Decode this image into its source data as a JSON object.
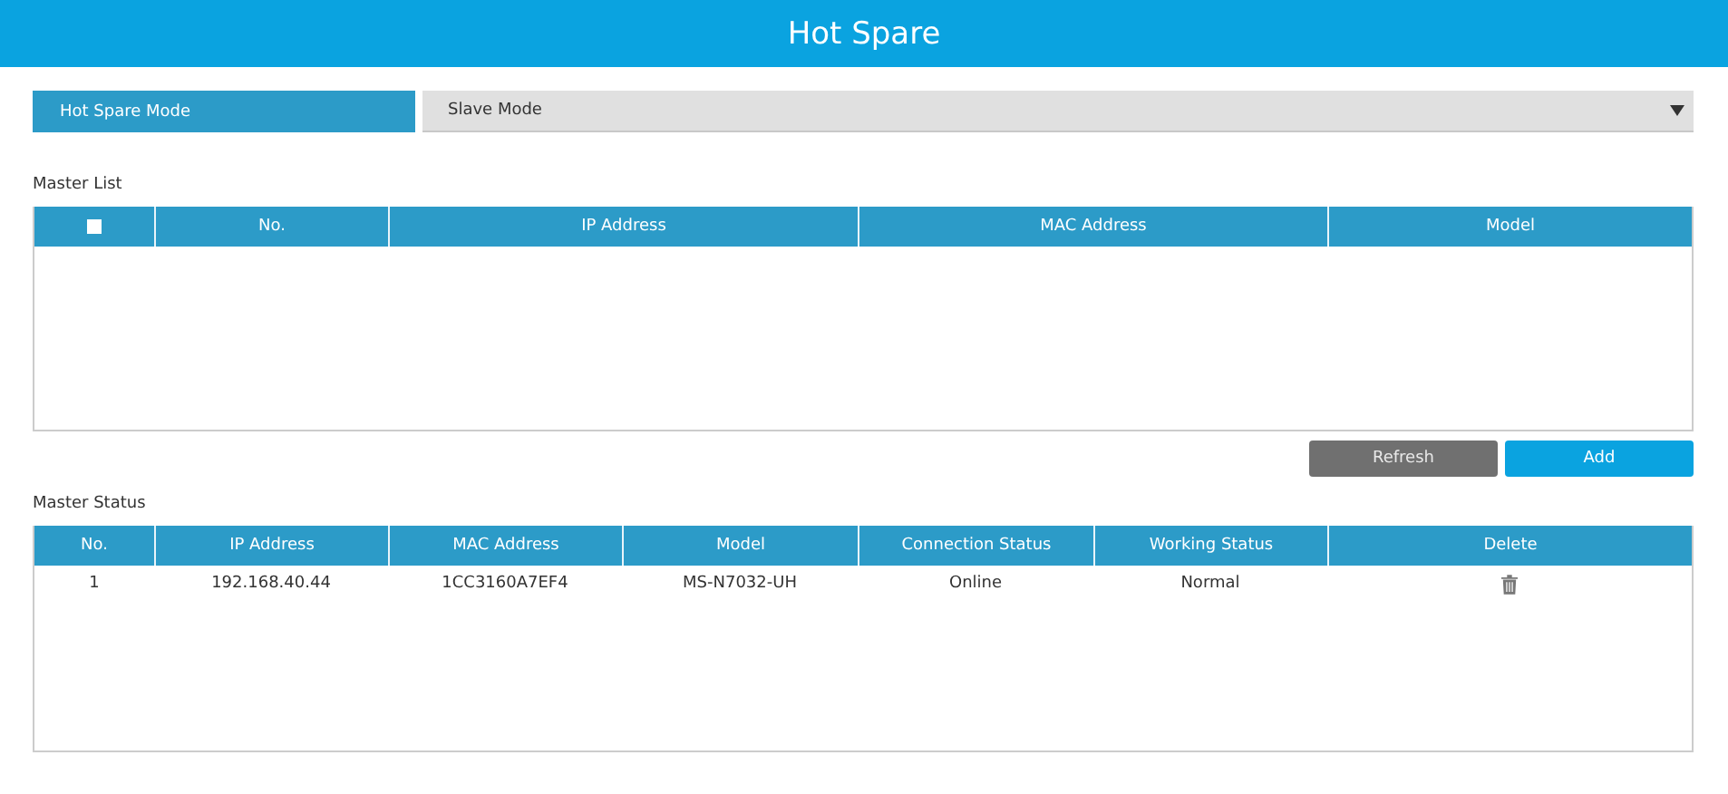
{
  "header": {
    "title": "Hot Spare"
  },
  "mode": {
    "label": "Hot Spare Mode",
    "value": "Slave Mode"
  },
  "master_list": {
    "title": "Master List",
    "select_all": {
      "checked": false
    },
    "columns": [
      "No.",
      "IP Address",
      "MAC Address",
      "Model"
    ]
  },
  "buttons": [
    {
      "label": "Refresh",
      "kind": "secondary"
    },
    {
      "label": "Add",
      "kind": "primary"
    }
  ],
  "master_status": {
    "title": "Master Status",
    "columns": [
      "No.",
      "IP Address",
      "MAC Address",
      "Model",
      "Connection Status",
      "Working Status",
      "Delete"
    ],
    "rows": [
      {
        "cells": [
          "1",
          "192.168.40.44",
          "1CC3160A7EF4",
          "MS-N7032-UH",
          "Online",
          "Normal"
        ]
      }
    ]
  }
}
